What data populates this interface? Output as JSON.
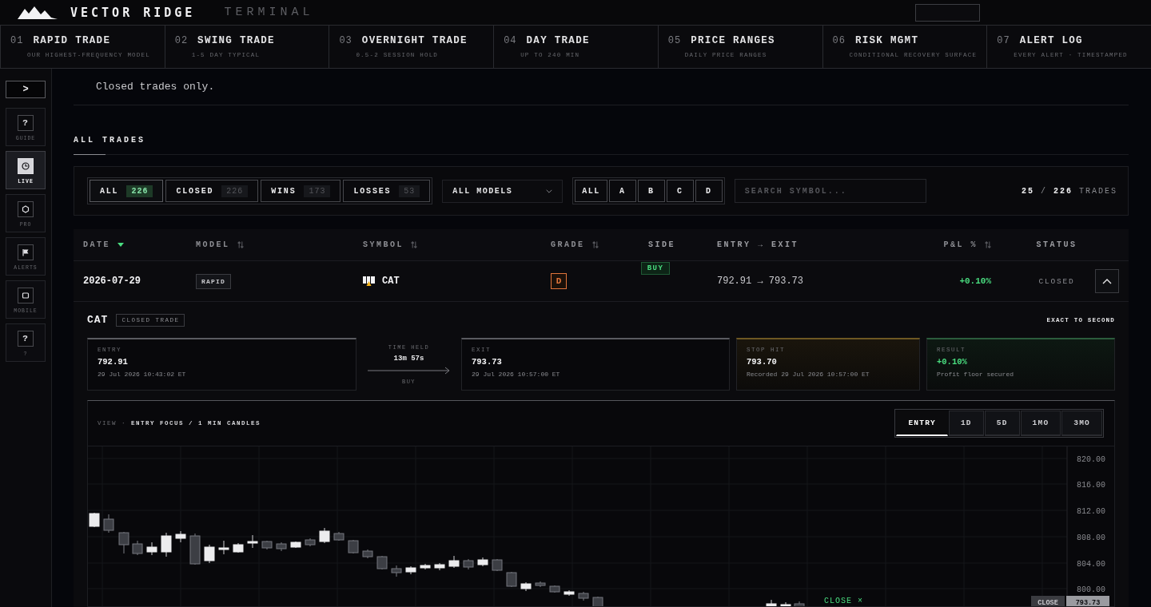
{
  "header": {
    "brand": "VECTOR RIDGE",
    "product": "TERMINAL"
  },
  "tabs": [
    {
      "number": "01",
      "title": "RAPID TRADE",
      "subtitle": "OUR HIGHEST-FREQUENCY MODEL"
    },
    {
      "number": "02",
      "title": "SWING TRADE",
      "subtitle": "1-5 DAY TYPICAL"
    },
    {
      "number": "03",
      "title": "OVERNIGHT TRADE",
      "subtitle": "0.5-2 SESSION HOLD"
    },
    {
      "number": "04",
      "title": "DAY TRADE",
      "subtitle": "UP TO 240 MIN"
    },
    {
      "number": "05",
      "title": "PRICE RANGES",
      "subtitle": "DAILY PRICE RANGES"
    },
    {
      "number": "06",
      "title": "RISK MGMT",
      "subtitle": "CONDITIONAL RECOVERY SURFACE"
    },
    {
      "number": "07",
      "title": "ALERT LOG",
      "subtitle": "EVERY ALERT · TIMESTAMPED"
    }
  ],
  "sidebar": {
    "toggle": ">",
    "items": [
      {
        "kind": "help",
        "glyph": "?",
        "label": "GUIDE",
        "selected": false
      },
      {
        "kind": "clock",
        "label": "LIVE",
        "selected": true
      },
      {
        "kind": "hexagon",
        "label": "PRO",
        "selected": false
      },
      {
        "kind": "flag",
        "label": "ALERTS",
        "selected": false
      },
      {
        "kind": "screen",
        "label": "MOBILE",
        "selected": false
      },
      {
        "kind": "help",
        "glyph": "?",
        "label": "?",
        "selected": false
      }
    ]
  },
  "notice": "Closed trades only.",
  "section_title": "ALL TRADES",
  "filters": {
    "outcomes": [
      {
        "label": "ALL",
        "count": "226",
        "selected": true
      },
      {
        "label": "CLOSED",
        "count": "226",
        "selected": false
      },
      {
        "label": "WINS",
        "count": "173",
        "selected": false
      },
      {
        "label": "LOSSES",
        "count": "53",
        "selected": false
      }
    ],
    "model": {
      "value": "ALL MODELS"
    },
    "grades": [
      {
        "label": "ALL"
      },
      {
        "label": "A"
      },
      {
        "label": "B"
      },
      {
        "label": "C"
      },
      {
        "label": "D"
      }
    ],
    "search": {
      "placeholder": "SEARCH SYMBOL..."
    },
    "total": "**25** / **226** TRADES"
  },
  "table": {
    "columns": [
      {
        "label": "DATE",
        "kind": "sortable",
        "sorted": true
      },
      {
        "label": "MODEL",
        "kind": "sortable",
        "sorted": false
      },
      {
        "label": "SYMBOL",
        "kind": "sortable",
        "sorted": false
      },
      {
        "label": "GRADE",
        "kind": "sortable",
        "sorted": false
      },
      {
        "label": "SIDE",
        "kind": "plain",
        "sorted": false
      },
      {
        "label": "ENTRY → EXIT",
        "kind": "plain",
        "sorted": false
      },
      {
        "label": "P&L %",
        "kind": "sortable",
        "sorted": false
      },
      {
        "label": "STATUS",
        "kind": "plain",
        "sorted": false
      }
    ],
    "rows": [
      {
        "date": "2026-07-29",
        "model": "RAPID",
        "symbol": "CAT",
        "grade": {
          "label": "D",
          "color": "#e0743a"
        },
        "side": {
          "label": "BUY",
          "kind": "buy"
        },
        "entry_exit": "792.91 → 793.73",
        "pnl": {
          "text": "+0.10%",
          "kind": "gain"
        },
        "status": "CLOSED",
        "expanded": true
      }
    ]
  },
  "detail": {
    "symbol": "CAT",
    "badge": "CLOSED TRADE",
    "precision": "EXACT TO SECOND",
    "cards": [
      {
        "kind": "price",
        "label": "ENTRY",
        "value": "792.91",
        "note": "29 Jul 2026 10:43:02 ET"
      },
      {
        "kind": "held",
        "label": "TIME HELD",
        "value": "13m 57s",
        "note": "BUY"
      },
      {
        "kind": "price",
        "label": "EXIT",
        "value": "793.73",
        "note": "29 Jul 2026 10:57:00 ET"
      },
      {
        "kind": "stop",
        "label": "STOP HIT",
        "value": "793.70",
        "note": "Recorded 29 Jul 2026 10:57:00 ET"
      },
      {
        "kind": "result",
        "label": "RESULT",
        "value": "+0.10%",
        "note": "Profit floor secured"
      }
    ],
    "chart": {
      "view": "VIEW · **ENTRY FOCUS / 1 MIN CANDLES**",
      "ranges": [
        {
          "label": "ENTRY",
          "selected": true
        },
        {
          "label": "1D",
          "selected": false
        },
        {
          "label": "5D",
          "selected": false
        },
        {
          "label": "1MO",
          "selected": false
        },
        {
          "label": "3MO",
          "selected": false
        }
      ],
      "price_labels": [
        "820.00",
        "816.00",
        "812.00",
        "808.00",
        "804.00",
        "800.00"
      ],
      "marker": "CLOSE ×",
      "tags": [
        "CLOSE",
        "793.73"
      ]
    }
  }
}
